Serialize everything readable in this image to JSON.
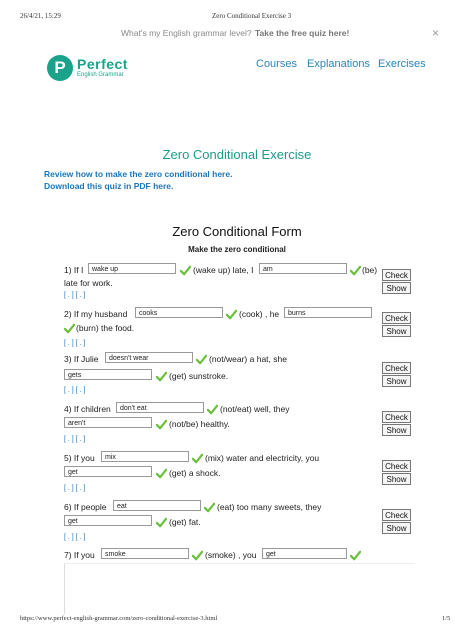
{
  "print_header": {
    "datetime": "26/4/21, 15:29",
    "page_title": "Zero Conditional Exercise 3"
  },
  "banner": {
    "question": "What's my English grammar level?",
    "cta": "Take the free quiz here!",
    "close": "×"
  },
  "logo": {
    "letter": "P",
    "name": "Perfect",
    "tagline": "English Grammar"
  },
  "nav": {
    "items": [
      "Courses",
      "Explanations",
      "Exercises"
    ]
  },
  "page": {
    "title": "Zero Conditional Exercise",
    "review_link": "Review how to make the zero conditional here.",
    "download_link": "Download this quiz in PDF here."
  },
  "form": {
    "title": "Zero Conditional Form",
    "subtitle": "Make the zero conditional"
  },
  "questions": [
    {
      "n": "1) If I",
      "a1": "wake up",
      "v1": "(wake up) late, I",
      "a2": "am",
      "v2": "(be)",
      "tail": "late for work."
    },
    {
      "n": "2) If my husband",
      "a1": "cooks",
      "v1": "(cook) , he",
      "a2": "burns",
      "v2": "(burn) the food."
    },
    {
      "n": "3) If Julie",
      "a1": "doesn't wear",
      "v1": "(not/wear) a hat, she",
      "a2": "gets",
      "v2": "(get) sunstroke."
    },
    {
      "n": "4) If children",
      "a1": "don't eat",
      "v1": "(not/eat) well, they",
      "a2": "aren't",
      "v2": "(not/be) healthy."
    },
    {
      "n": "5) If you",
      "a1": "mix",
      "v1": "(mix) water and electricity, you",
      "a2": "get",
      "v2": "(get) a shock."
    },
    {
      "n": "6) If people",
      "a1": "eat",
      "v1": "(eat) too many sweets, they",
      "a2": "get",
      "v2": "(get) fat."
    },
    {
      "n": "7) If you",
      "a1": "smoke",
      "v1": "(smoke) , you",
      "a2": "get",
      "v2": ""
    }
  ],
  "buttons": {
    "check": "Check",
    "show": "Show"
  },
  "hint": "[ . ] [ . ]",
  "print_footer": {
    "url": "https://www.perfect-english-grammar.com/zero-conditional-exercise-3.html",
    "page": "1/5"
  },
  "colors": {
    "brand": "#1aa38a",
    "link": "#1c75b8",
    "title": "#1d9b8b",
    "tick": "#6abf3b"
  }
}
